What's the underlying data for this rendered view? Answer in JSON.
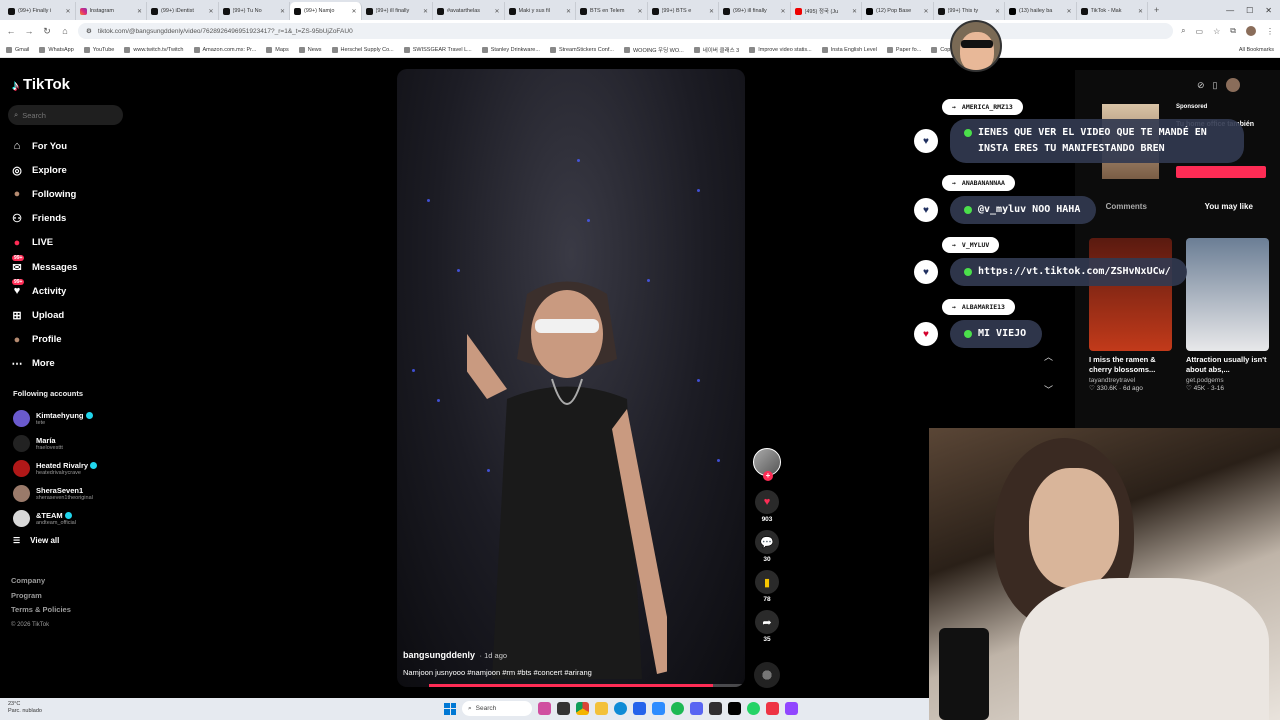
{
  "browser": {
    "tabs": [
      {
        "label": "(99+) Finally i",
        "icon": "tiktok"
      },
      {
        "label": "Instagram",
        "icon": "instagram"
      },
      {
        "label": "(99+) iDentist",
        "icon": "tiktok"
      },
      {
        "label": "(99+) Tu No",
        "icon": "tiktok"
      },
      {
        "label": "(99+) Namjo",
        "icon": "tiktok",
        "active": true
      },
      {
        "label": "(99+) ill finally",
        "icon": "tiktok"
      },
      {
        "label": "#avatarthelas",
        "icon": "tiktok"
      },
      {
        "label": "Maki y sus fil",
        "icon": "tiktok"
      },
      {
        "label": "BTS en Telem",
        "icon": "tiktok"
      },
      {
        "label": "(99+) BTS e",
        "icon": "tiktok"
      },
      {
        "label": "(99+) ill finally",
        "icon": "tiktok"
      },
      {
        "label": "(495) 정국 (Ju",
        "icon": "youtube"
      },
      {
        "label": "(12) Pop Base",
        "icon": "x"
      },
      {
        "label": "(99+) This ty",
        "icon": "tiktok"
      },
      {
        "label": "(13) hailey ba",
        "icon": "x"
      },
      {
        "label": "TikTok - Mak",
        "icon": "tiktok"
      }
    ],
    "url": "tiktok.com/@bangsungddenly/video/7628926496951923417?_r=1&_t=ZS-95bUjZoFAU0",
    "bookmarks": [
      "Gmail",
      "WhatsApp",
      "YouTube",
      "www.twitch.tv/Twitch",
      "Amazon.com.mx: Pr...",
      "Maps",
      "News",
      "Herschel Supply Co...",
      "SWISSGEAR Travel L...",
      "Stanley Drinkware...",
      "StreamStickers Conf...",
      "WOOING 우딩 WO...",
      "네이버 클래스 3",
      "Improve video statis...",
      "Insta English Level",
      "Paper fo...",
      "Copic Sketch Marke..."
    ],
    "all_bookmarks": "All Bookmarks"
  },
  "tiktok": {
    "logo": "TikTok",
    "search_placeholder": "Search",
    "nav": [
      {
        "label": "For You",
        "icon": "home-icon"
      },
      {
        "label": "Explore",
        "icon": "compass-icon"
      },
      {
        "label": "Following",
        "icon": "following-icon"
      },
      {
        "label": "Friends",
        "icon": "friends-icon"
      },
      {
        "label": "LIVE",
        "icon": "live-icon"
      },
      {
        "label": "Messages",
        "icon": "messages-icon",
        "badge": "99+"
      },
      {
        "label": "Activity",
        "icon": "activity-icon",
        "badge": "99+"
      },
      {
        "label": "Upload",
        "icon": "upload-icon"
      },
      {
        "label": "Profile",
        "icon": "profile-icon"
      },
      {
        "label": "More",
        "icon": "more-icon"
      }
    ],
    "following_title": "Following accounts",
    "following": [
      {
        "name": "Kimtaehyung",
        "handle": "tete",
        "verified": true,
        "color": "#6a5acd"
      },
      {
        "name": "María",
        "handle": "fraelovesttt",
        "verified": false,
        "color": "#222"
      },
      {
        "name": "Heated Rivalry",
        "handle": "heatedrivalrycrave",
        "verified": true,
        "color": "#b01818"
      },
      {
        "name": "SheraSeven1",
        "handle": "sheraseven1theoriginal",
        "verified": false,
        "color": "#9a7a6a"
      },
      {
        "name": "&TEAM",
        "handle": "andteam_official",
        "verified": true,
        "color": "#d8d8d8"
      }
    ],
    "view_all": "View all",
    "footer": [
      "Company",
      "Program",
      "Terms & Policies"
    ],
    "copyright": "© 2026 TikTok"
  },
  "video": {
    "username": "bangsungddenly",
    "ago": "· 1d ago",
    "caption": "Namjoon jusnyooo #namjoon #rm #bts #concert #arirang",
    "progress": 0.9,
    "likes": "903",
    "comments": "30",
    "saves": "78",
    "shares": "35"
  },
  "chat": [
    {
      "user": "AMERICA_RMZ13",
      "message": "IENES QUE VER EL VIDEO QUE TE MANDÉ EN INSTA ERES TU MANIFESTANDO BREN",
      "heart": "navy"
    },
    {
      "user": "ANABANANNAA",
      "message": "@v_myluv NOO HAHA",
      "heart": "navy"
    },
    {
      "user": "V_MYLUV",
      "message": "https://vt.tiktok.com/ZSHvNxUCw/",
      "heart": "navy"
    },
    {
      "user": "ALBAMARIE13",
      "message": "MI VIEJO",
      "heart": "red"
    }
  ],
  "recommend": {
    "sponsored": "Sponsored",
    "sponsored_title": "Tu home office también",
    "tabs": [
      "Comments",
      "You may like"
    ],
    "cards": [
      {
        "caption": "I miss the ramen & cherry blossoms...",
        "author": "tayandtreytravel",
        "stats": "♡ 330.6K · 6d ago"
      },
      {
        "caption": "Attraction usually isn't about abs,...",
        "author": "get.podgems",
        "stats": "♡ 45K · 3-16"
      }
    ]
  },
  "taskbar": {
    "weather_temp": "23°C",
    "weather_desc": "Parc. nublado",
    "search": "Search"
  }
}
